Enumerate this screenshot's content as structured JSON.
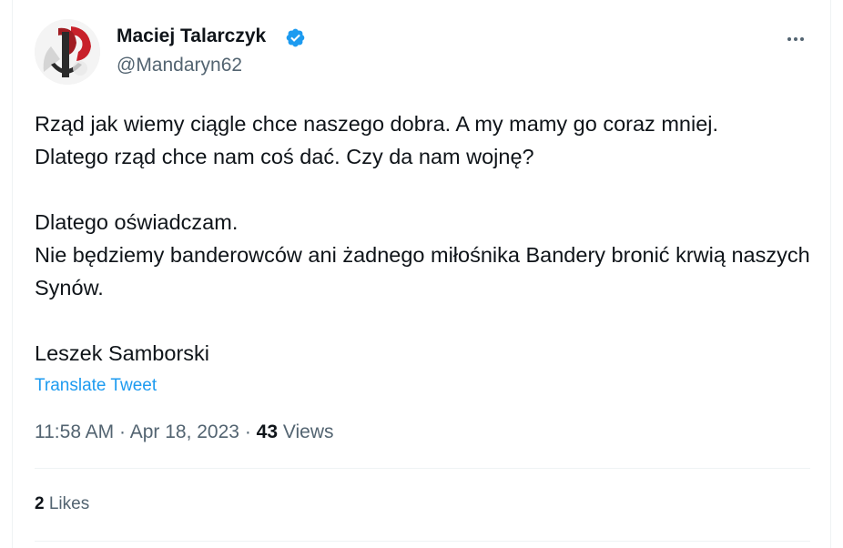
{
  "author": {
    "display_name": "Maciej Talarczyk",
    "handle": "@Mandaryn62",
    "verified_icon": "verified-badge-icon",
    "avatar_icon": "kotwica-symbol-avatar"
  },
  "menu": {
    "icon": "more-horizontal-icon"
  },
  "tweet": {
    "paragraphs": [
      "Rząd jak wiemy ciągle chce naszego dobra. A my mamy go coraz mniej.",
      "Dlatego rząd chce nam coś dać. Czy da nam wojnę?",
      "Dlatego oświadczam.",
      "Nie będziemy banderowców ani żadnego miłośnika Bandery bronić krwią naszych Synów.",
      "Leszek Samborski"
    ],
    "translate_label": "Translate Tweet"
  },
  "meta": {
    "time": "11:58 AM",
    "separator": "·",
    "date": "Apr 18, 2023",
    "views_count": "43",
    "views_label": "Views"
  },
  "stats": {
    "likes_count": "2",
    "likes_label": "Likes"
  },
  "colors": {
    "accent": "#1d9bf0",
    "text_primary": "#0f1419",
    "text_secondary": "#536471",
    "divider": "#eff3f4"
  }
}
